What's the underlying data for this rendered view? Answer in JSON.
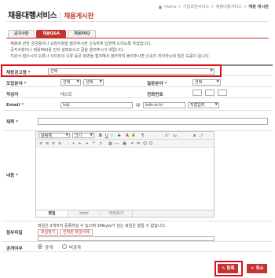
{
  "header": {
    "title": "채용대행서비스",
    "subtitle": "채용게시판",
    "breadcrumb": [
      "Home",
      "기업회원서비스",
      "채용대행서비스",
      "채용 게시판"
    ]
  },
  "tabs": [
    {
      "label": "공지사항",
      "active": false
    },
    {
      "label": "채용Q&A",
      "active": true
    },
    {
      "label": "채용FAQ",
      "active": false
    }
  ],
  "notices": [
    "· 채용에 관한 궁금증이나 요청사항을 올려주시면 신속하게 답변해 드리도록 하겠습니다.",
    "· 공지사항이나 채용FAQ를 먼저 살펴보시고 글을 올려주시기 바랍니다.",
    "· 지원서 접수시의 오류나 사이트의 오류 등은 화면을 캡쳐해서 첨부하여 올려주시면 신속히 처리하는데 많은 도움이 됩니다."
  ],
  "form": {
    "recruit_label": "채용공고명",
    "recruit_value": "선택",
    "field_label": "모집분야",
    "field_value": "선택",
    "field_value2": "선택",
    "qtype_label": "질문분야",
    "qtype_value": "선택",
    "author_label": "작성자",
    "author_value": "테스트",
    "phone_label": "전화번호",
    "email_label": "Email",
    "email_id": "hsjl",
    "email_at": "@",
    "email_domain": "kels.or.kr",
    "email_select": "직접입력",
    "subject_label": "제목",
    "content_label": "내용",
    "attach_label": "첨부파일",
    "attach_note": "파일은 3개까지 등록하실 수 있으며 3Mbyte가 넘는 파일은 올릴 수 없습니다.",
    "attach_btn_find": "파일찾기",
    "attach_btn_delete": "선택된 파일삭제",
    "public_label": "공개여부",
    "public_option": "공개",
    "private_option": "비공개"
  },
  "editor": {
    "font": "굴림체",
    "size": "크기",
    "tabs": [
      "편집",
      "html",
      "미리보기"
    ]
  },
  "buttons": {
    "submit": "등록",
    "cancel": "취소"
  },
  "colors": {
    "accent": "#c4332f",
    "highlight": "#e0101a"
  }
}
